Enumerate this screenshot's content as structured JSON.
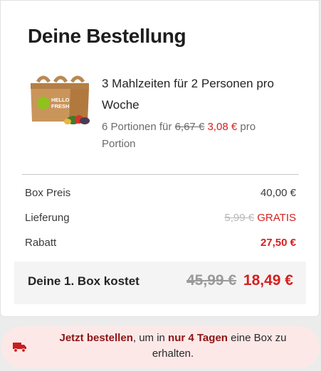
{
  "order": {
    "title": "Deine Bestellung",
    "product_name": "3 Mahlzeiten für 2 Personen pro Woche",
    "portion_prefix": "6 Portionen für",
    "portion_old_price": "6,67 €",
    "portion_new_price": "3,08 €",
    "portion_suffix": "pro Portion",
    "box_logo": [
      "HELLO",
      "FRESH"
    ]
  },
  "summary": {
    "box_price_label": "Box Preis",
    "box_price_value": "40,00 €",
    "delivery_label": "Lieferung",
    "delivery_old_value": "5,99 €",
    "delivery_value": "GRATIS",
    "discount_label": "Rabatt",
    "discount_value": "27,50 €"
  },
  "total": {
    "label": "Deine 1. Box kostet",
    "old_value": "45,99 €",
    "value": "18,49 €"
  },
  "banner": {
    "icon": "truck-icon",
    "cta": "Jetzt bestellen",
    "text_mid": ", um in ",
    "highlight": "nur 4 Tagen",
    "text_end": " eine Box zu erhalten."
  },
  "colors": {
    "accent_red": "#d61f1f",
    "banner_bg": "#fde8e8",
    "banner_highlight": "#8c1414",
    "brand_green": "#91c11e"
  }
}
